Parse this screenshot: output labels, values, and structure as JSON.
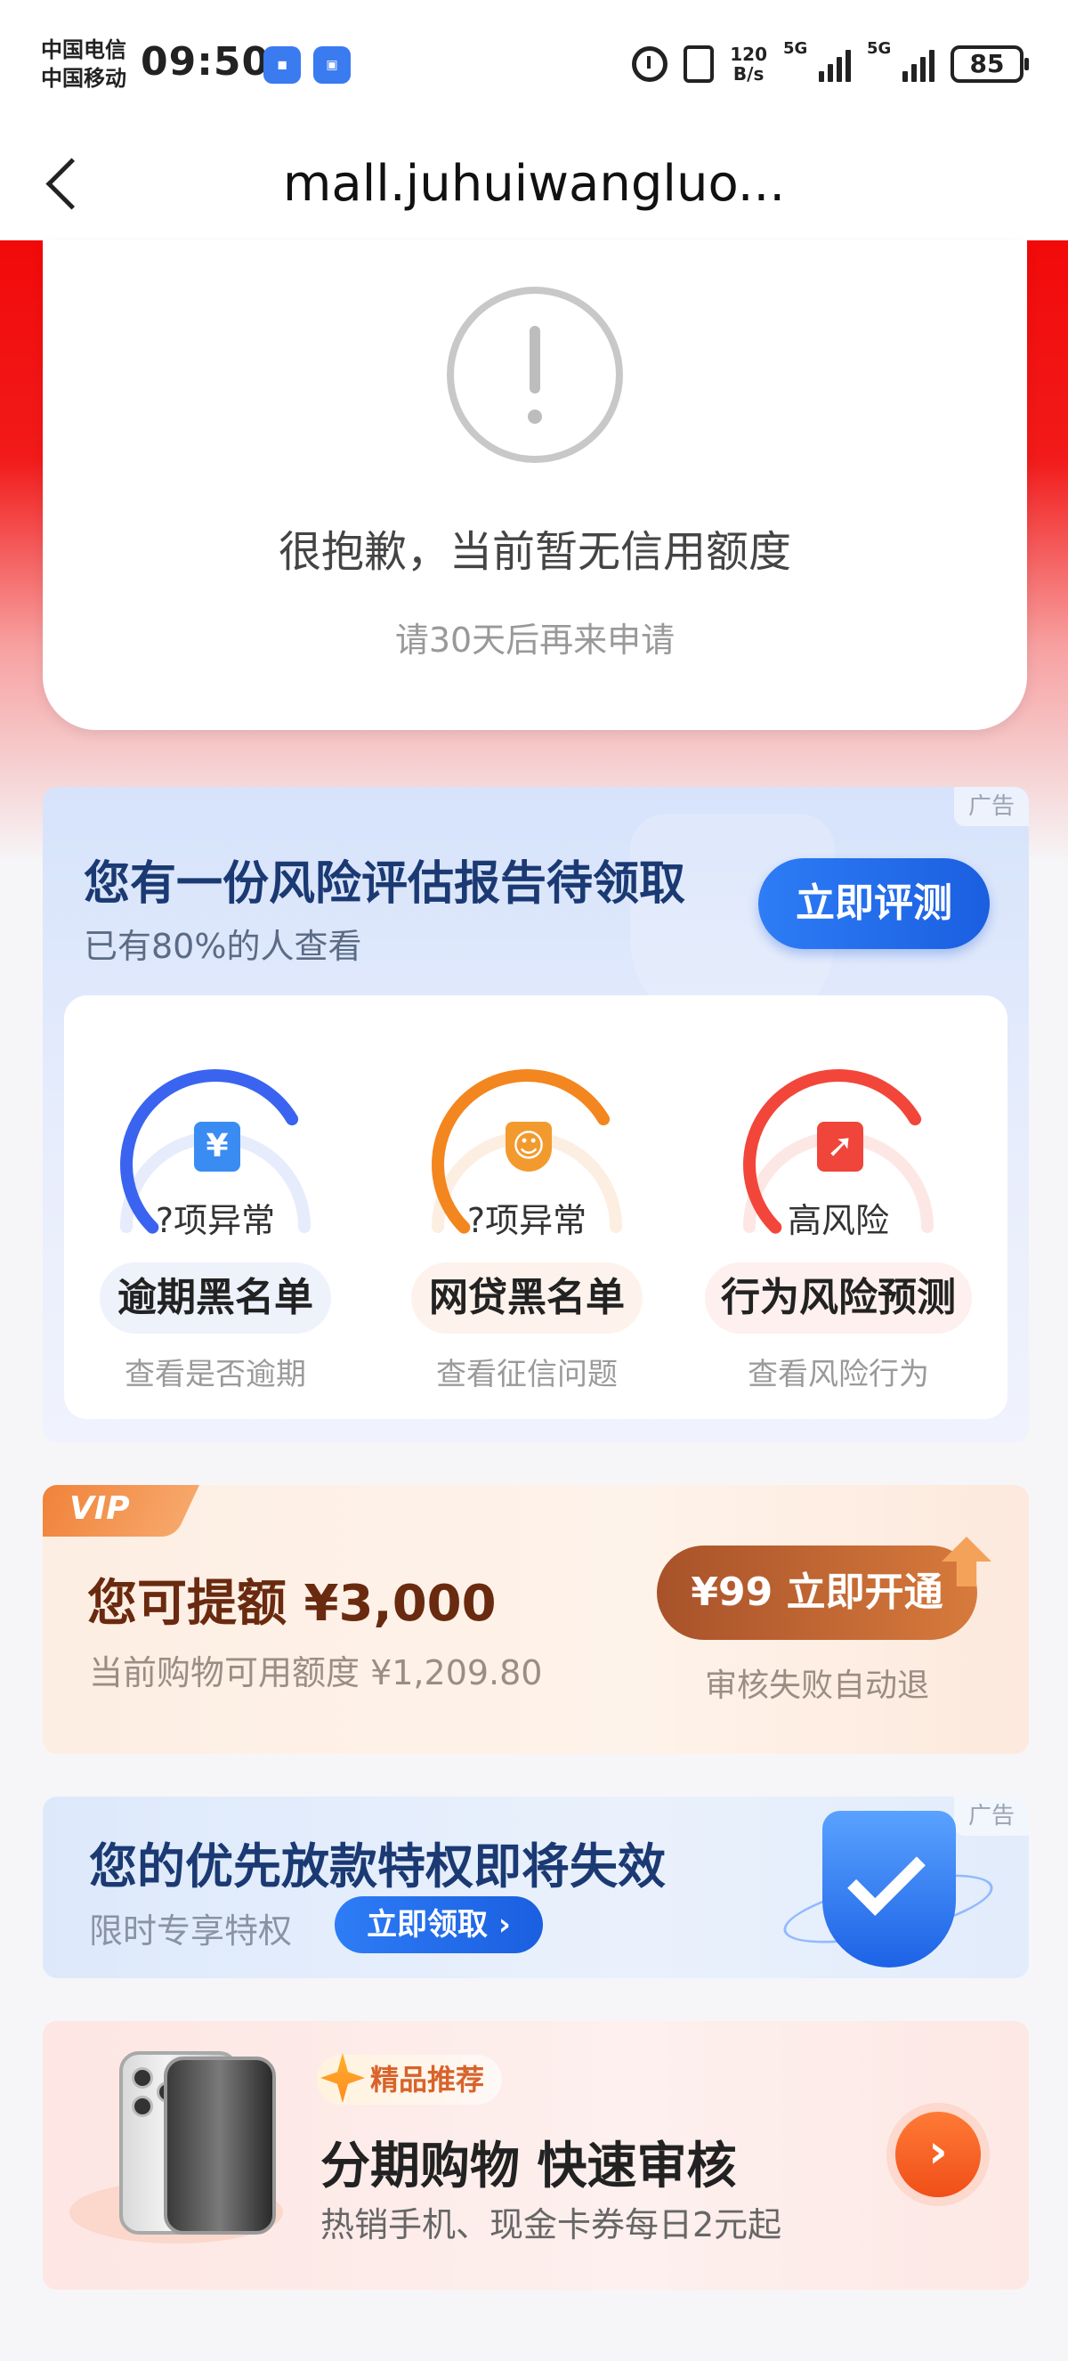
{
  "status_bar": {
    "carrier_1": "中国电信",
    "carrier_2": "中国移动",
    "time": "09:50",
    "net_speed_value": "120",
    "net_speed_unit": "B/s",
    "signal_1": "5G",
    "signal_2": "5G",
    "battery": "85"
  },
  "title_bar": {
    "url": "mall.juhuiwangluo..."
  },
  "credit": {
    "title": "很抱歉，当前暂无信用额度",
    "subtitle": "请30天后再来申请"
  },
  "risk_report": {
    "ad_label": "广告",
    "title": "您有一份风险评估报告待领取",
    "subtitle": "已有80%的人查看",
    "button": "立即评测",
    "gauges": [
      {
        "icon": "¥",
        "status": "?项异常",
        "name": "逾期黑名单",
        "desc": "查看是否逾期",
        "color": "#3a64f0",
        "level": 0.72
      },
      {
        "icon": "person",
        "status": "?项异常",
        "name": "网贷黑名单",
        "desc": "查看征信问题",
        "color": "#f3861f",
        "level": 0.72
      },
      {
        "icon": "cursor",
        "status": "高风险",
        "name": "行为风险预测",
        "desc": "查看风险行为",
        "color": "#f2463a",
        "level": 0.72
      }
    ]
  },
  "vip": {
    "badge": "VIP",
    "title": "您可提额 ¥3,000",
    "subtitle": "当前购物可用额度 ¥1,209.80",
    "button": "¥99 立即开通",
    "note": "审核失败自动退"
  },
  "priority": {
    "ad_label": "广告",
    "title": "您的优先放款特权即将失效",
    "subtitle": "限时专享特权",
    "button": "立即领取 ›"
  },
  "shopping": {
    "tag": "精品推荐",
    "title": "分期购物  快速审核",
    "subtitle": "热销手机、现金卡券每日2元起"
  }
}
